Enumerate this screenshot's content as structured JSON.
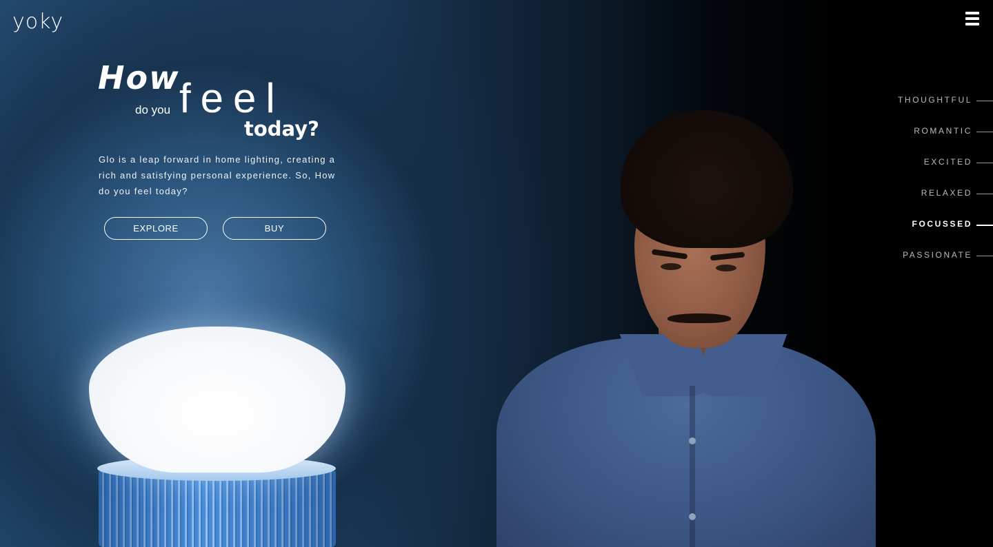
{
  "header": {
    "logo_text": "yoky",
    "menu_icon": "hamburger-menu-icon"
  },
  "hero": {
    "headline": {
      "how": "How",
      "do_you": "do you",
      "feel": "feel",
      "today": "today?"
    },
    "description": "Glo is a leap forward in home lighting, creating a rich and satisfying personal experience. So, How do you feel today?",
    "buttons": {
      "explore": "EXPLORE",
      "buy": "BUY"
    }
  },
  "moods": {
    "items": [
      {
        "label": "THOUGHTFUL",
        "active": false
      },
      {
        "label": "ROMANTIC",
        "active": false
      },
      {
        "label": "EXCITED",
        "active": false
      },
      {
        "label": "RELAXED",
        "active": false
      },
      {
        "label": "FOCUSSED",
        "active": true
      },
      {
        "label": "PASSIONATE",
        "active": false
      }
    ]
  },
  "colors": {
    "background_left": "#23496e",
    "background_right": "#000000",
    "bulb_base": "#3f86d6",
    "shirt": "#3c5684"
  }
}
